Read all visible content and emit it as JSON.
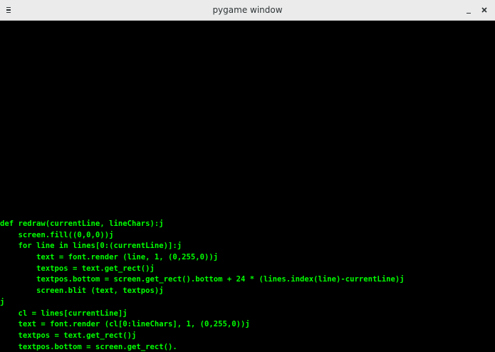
{
  "window": {
    "title": "pygame window",
    "menu_icon": "hamburger-menu-icon",
    "minimize_icon": "minimize-icon",
    "close_icon": "close-icon"
  },
  "colors": {
    "titlebar_bg": "#ebebeb",
    "canvas_bg": "#000000",
    "code_text": "#00ff00"
  },
  "code_lines": [
    "def redraw(currentLine, lineChars):j",
    "    screen.fill((0,0,0))j",
    "    for line in lines[0:(currentLine)]:j",
    "        text = font.render (line, 1, (0,255,0))j",
    "        textpos = text.get_rect()j",
    "        textpos.bottom = screen.get_rect().bottom + 24 * (lines.index(line)-currentLine)j",
    "        screen.blit (text, textpos)j",
    "j",
    "    cl = lines[currentLine]j",
    "    text = font.render (cl[0:lineChars], 1, (0,255,0))j",
    "    textpos = text.get_rect()j",
    "    textpos.bottom = screen.get_rect()."
  ]
}
